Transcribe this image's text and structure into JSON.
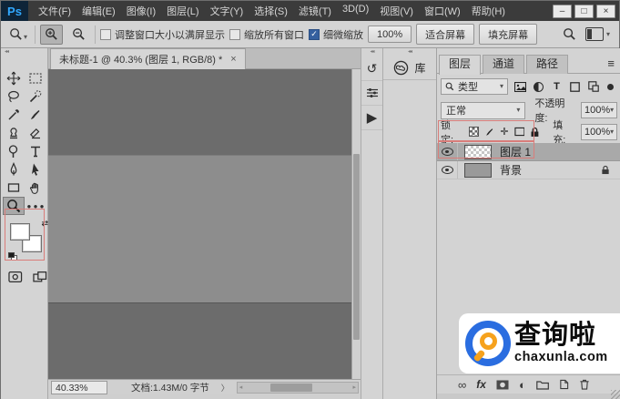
{
  "titlebar": {
    "logo": "Ps",
    "menus": [
      "文件(F)",
      "编辑(E)",
      "图像(I)",
      "图层(L)",
      "文字(Y)",
      "选择(S)",
      "滤镜(T)",
      "3D(D)",
      "视图(V)",
      "窗口(W)",
      "帮助(H)"
    ],
    "minimize": "–",
    "maximize": "□",
    "close": "×"
  },
  "options": {
    "resize_windows_label": "调整窗口大小以满屏显示",
    "zoom_all_label": "缩放所有窗口",
    "scrubby_zoom_label": "细微缩放",
    "zoom_100_label": "100%",
    "fit_screen_label": "适合屏幕",
    "fill_screen_label": "填充屏幕",
    "check_glyph": "✓"
  },
  "doc": {
    "tab_title": "未标题-1 @ 40.3% (图层 1, RGB/8) *",
    "close_glyph": "×",
    "zoom_percent": "40.33%",
    "doc_size": "文档:1.43M/0 字节",
    "status_arrow": "〉"
  },
  "strips": {
    "collapse_glyph": "◂◂",
    "library_label": "库"
  },
  "layers_panel": {
    "tabs": [
      {
        "label": "图层"
      },
      {
        "label": "通道"
      },
      {
        "label": "路径"
      }
    ],
    "menu_glyph": "≡",
    "filter_type_label": "类型",
    "blend_mode": "正常",
    "opacity_label": "不透明度:",
    "opacity_value": "100%",
    "lock_label": "锁定:",
    "fill_label": "填充:",
    "fill_value": "100%",
    "layers": [
      {
        "name": "图层 1"
      },
      {
        "name": "背景"
      }
    ],
    "fx_label": "fx"
  },
  "icons": {
    "caret": "▾",
    "dots": "● ● ●",
    "history": "↺",
    "play": "▶",
    "link_infinity": "∞",
    "adjust_half": "◐",
    "swap": "⇄",
    "type_t": "T",
    "move_plus": "✛",
    "scroll_left": "◂",
    "scroll_right": "▸"
  },
  "watermark": {
    "title": "查询啦",
    "domain": "chaxunla.com"
  },
  "colors": {
    "ps_blue": "#31a8ff",
    "annotation_red": "#d97d7a",
    "watermark_blue": "#2a6de0",
    "watermark_orange": "#f6a21d"
  }
}
